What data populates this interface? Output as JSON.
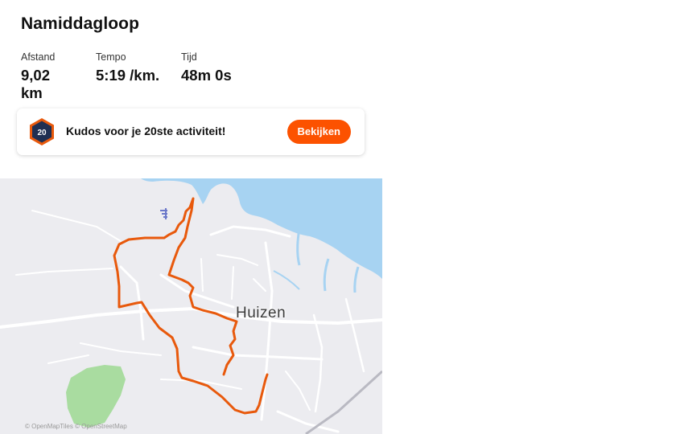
{
  "activity": {
    "title": "Namiddagloop"
  },
  "stats": [
    {
      "label": "Afstand",
      "value": "9,02 km"
    },
    {
      "label": "Tempo",
      "value": "5:19 /km."
    },
    {
      "label": "Tijd",
      "value": "48m 0s"
    }
  ],
  "kudos": {
    "badge_number": "20",
    "message": "Kudos voor je 20ste activiteit!",
    "button_label": "Bekijken"
  },
  "map": {
    "place_label": "Huizen",
    "attribution": "© OpenMapTiles © OpenStreetMap",
    "route_color": "#e8590c",
    "water_color": "#a7d3f2",
    "park_color": "#a9dca0"
  }
}
